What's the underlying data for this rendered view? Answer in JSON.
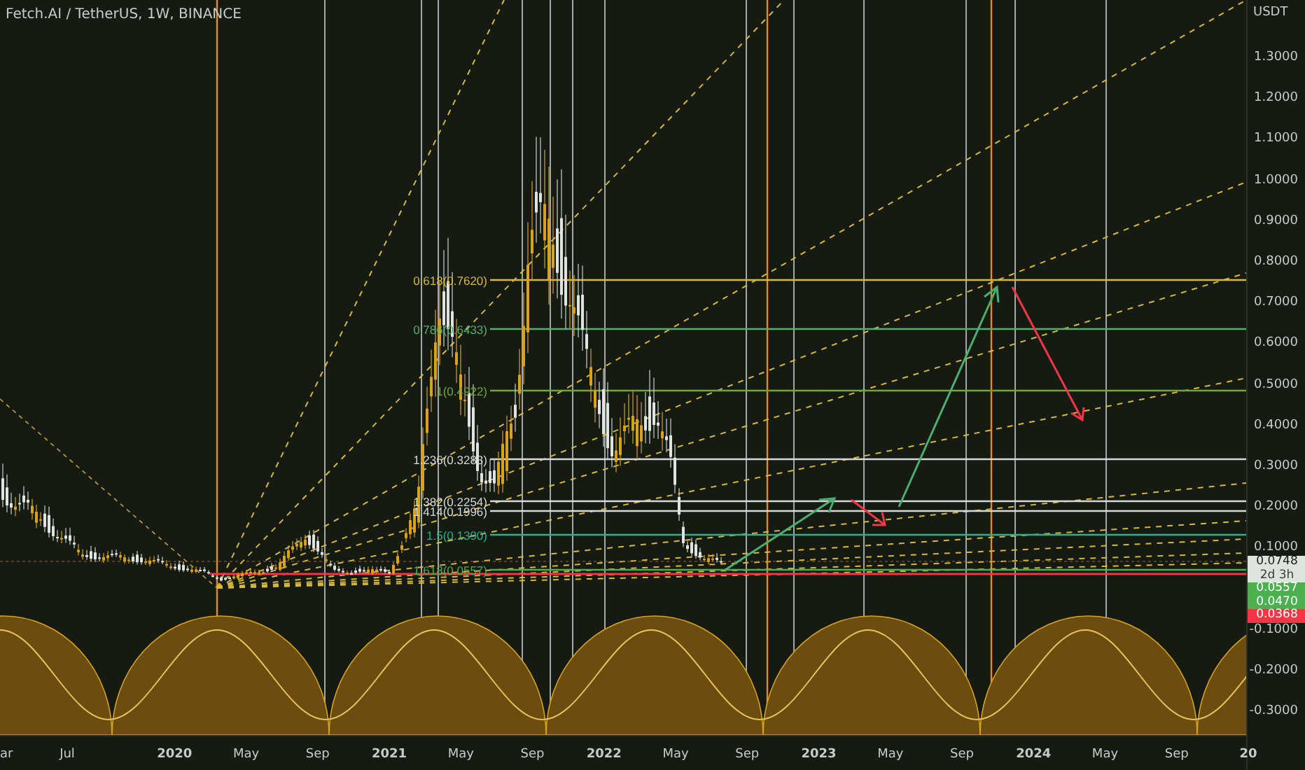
{
  "chart": {
    "title": "Fetch.AI / TetherUS, 1W, BINANCE",
    "currency": "USDT",
    "price_ticks": [
      "1.3000",
      "1.2000",
      "1.1000",
      "1.0000",
      "0.9000",
      "0.8000",
      "0.7000",
      "0.6000",
      "0.5000",
      "0.4000",
      "0.3000",
      "0.2000",
      "0.1000",
      "-0.1000",
      "-0.2000",
      "-0.3000"
    ],
    "fib_levels": [
      {
        "label": "0.618(0.7620)",
        "color": "#d9b83c"
      },
      {
        "label": "0.786(0.6433)",
        "color": "#52b06f"
      },
      {
        "label": "1(0.4922)",
        "color": "#6fa83a"
      },
      {
        "label": "1.236(0.3283)",
        "color": "#d8d8d8"
      },
      {
        "label": "1.382(0.2254)",
        "color": "#d8d8d8"
      },
      {
        "label": "1.414(0.1996)",
        "color": "#d8d8d8"
      },
      {
        "label": "1.5(0.1390)",
        "color": "#2fae8c"
      },
      {
        "label": "1.618(0.0557)",
        "color": "#4caf50"
      }
    ],
    "badges": [
      {
        "text": "0.0748",
        "sub": "2d 3h",
        "color": "#dfe3df"
      },
      {
        "text": "0.0557",
        "color": "#4caf50"
      },
      {
        "text": "0.0470",
        "color": "#4caf50"
      },
      {
        "text": "0.0368",
        "color": "#f23645"
      }
    ],
    "time_labels": [
      "ar",
      "Jul",
      "2020",
      "May",
      "Sep",
      "2021",
      "May",
      "Sep",
      "2022",
      "May",
      "Sep",
      "2023",
      "May",
      "Sep",
      "2024",
      "May",
      "Sep",
      "20"
    ]
  }
}
